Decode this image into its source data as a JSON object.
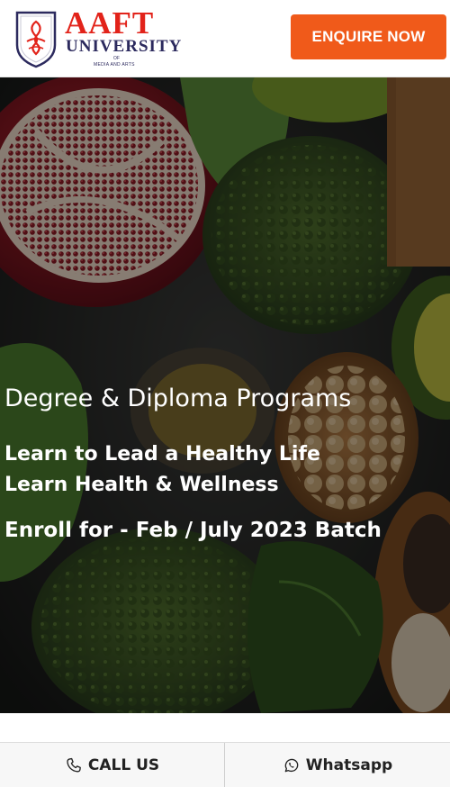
{
  "header": {
    "logo": {
      "word": "AAFT",
      "university": "UNIVERSITY",
      "of": "OF",
      "sub": "MEDIA AND ARTS"
    },
    "enquire_label": "ENQUIRE NOW",
    "accent_color": "#f05a1a"
  },
  "hero": {
    "line1": "Degree & Diploma Programs",
    "line2": "Learn to Lead a Healthy Life",
    "line3": "Learn Health & Wellness",
    "line4": "Enroll for - Feb / July 2023 Batch"
  },
  "bottom_bar": {
    "call_label": "CALL US",
    "call_icon": "phone-icon",
    "whatsapp_label": "Whatsapp",
    "whatsapp_icon": "whatsapp-icon"
  }
}
